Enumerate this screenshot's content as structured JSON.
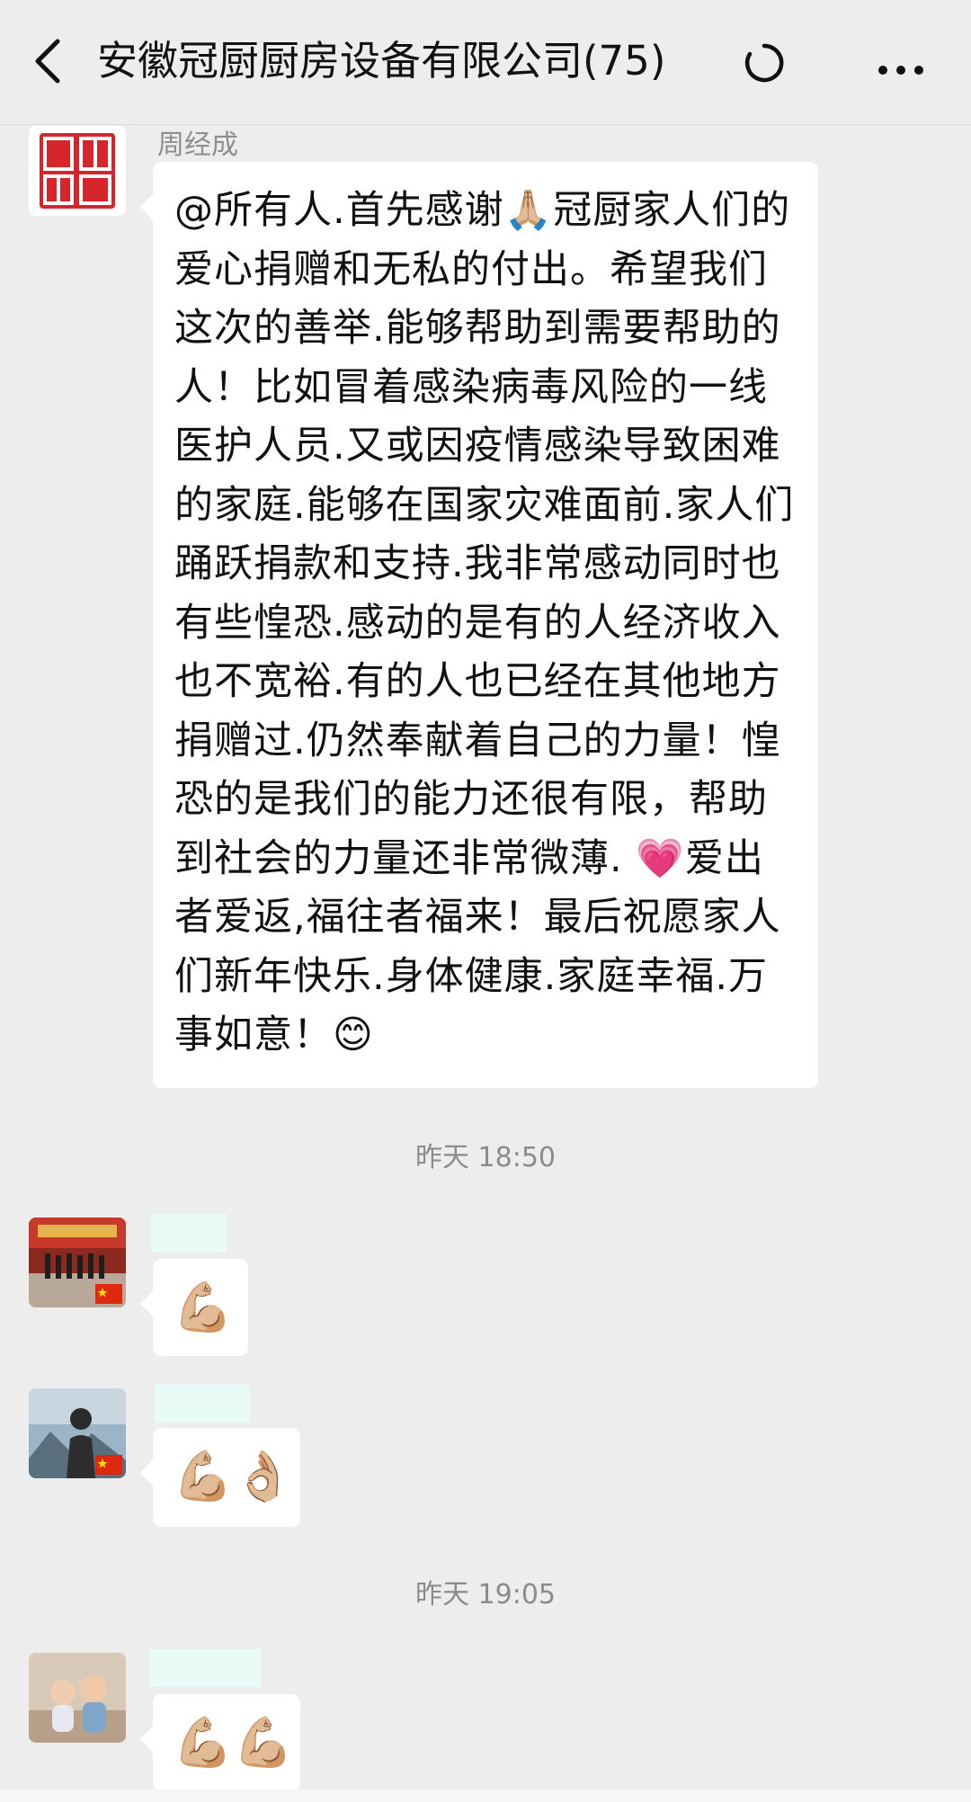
{
  "header": {
    "title": "安徽冠厨厨房设备有限公司(75)",
    "back_icon": "chevron-left-icon",
    "status_icon": "loading-ring-icon",
    "more_icon": "more-dots-icon"
  },
  "messages": [
    {
      "sender": "周经成",
      "avatar": "company-logo-avatar",
      "text": "@所有人.首先感谢🙏🏼冠厨家人们的爱心捐赠和无私的付出。希望我们这次的善举.能够帮助到需要帮助的人！比如冒着感染病毒风险的一线医护人员.又或因疫情感染导致困难的家庭.能够在国家灾难面前.家人们踊跃捐款和支持.我非常感动同时也有些惶恐.感动的是有的人经济收入也不宽裕.有的人也已经在其他地方捐赠过.仍然奉献着自己的力量！惶恐的是我们的能力还很有限，帮助到社会的力量还非常微薄. 💗爱出者爱返,福往者福来！最后祝愿家人们新年快乐.身体健康.家庭幸福.万事如意！😊"
    },
    {
      "sender": "",
      "avatar": "group-photo-avatar",
      "text": "💪🏼"
    },
    {
      "sender": "",
      "avatar": "mountain-person-avatar",
      "text": "💪🏼👌🏼"
    },
    {
      "sender": "",
      "avatar": "children-photo-avatar",
      "text": "💪🏼💪🏼"
    }
  ],
  "timestamps": [
    "昨天 18:50",
    "昨天 19:05"
  ],
  "colors": {
    "background": "#ededed",
    "bubble": "#ffffff",
    "logo_red": "#d7262b",
    "name_placeholder": "#e9fbf7"
  }
}
